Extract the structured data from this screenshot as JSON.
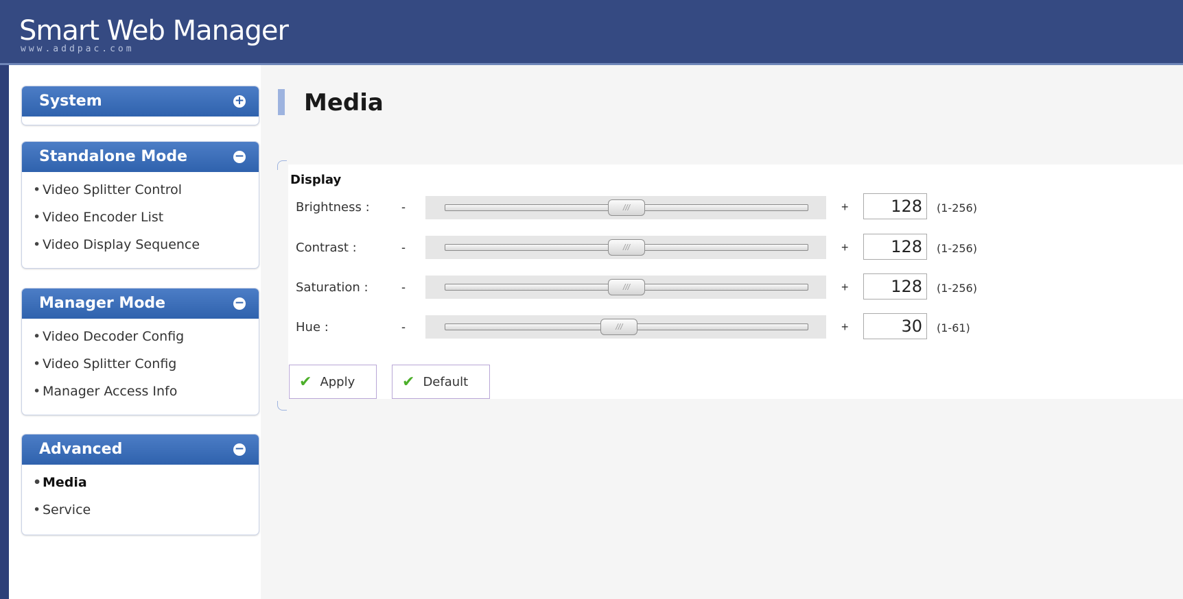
{
  "header": {
    "title": "Smart Web Manager",
    "subtitle": "www.addpac.com"
  },
  "sidebar": {
    "panels": [
      {
        "title": "System",
        "toggle": "+",
        "items": []
      },
      {
        "title": "Standalone Mode",
        "toggle": "−",
        "items": [
          "Video Splitter Control",
          "Video Encoder List",
          "Video Display Sequence"
        ]
      },
      {
        "title": "Manager Mode",
        "toggle": "−",
        "items": [
          "Video Decoder Config",
          "Video Splitter Config",
          "Manager Access Info"
        ]
      },
      {
        "title": "Advanced",
        "toggle": "−",
        "items": [
          "Media",
          "Service"
        ],
        "active_item": "Media"
      }
    ]
  },
  "main": {
    "page_title": "Media",
    "section_title": "Display",
    "minus_symbol": "-",
    "plus_symbol": "+",
    "slider_grip": "///",
    "rows": [
      {
        "label": "Brightness :",
        "value": "128",
        "range": "(1-256)",
        "level": 0.5
      },
      {
        "label": "Contrast :",
        "value": "128",
        "range": "(1-256)",
        "level": 0.5
      },
      {
        "label": "Saturation :",
        "value": "128",
        "range": "(1-256)",
        "level": 0.5
      },
      {
        "label": "Hue :",
        "value": "30",
        "range": "(1-61)",
        "level": 0.48
      }
    ],
    "buttons": {
      "apply": "Apply",
      "default": "Default",
      "check_icon": "✔"
    }
  },
  "colors": {
    "header_bg": "#354a82",
    "panel_head": "#2f62ad",
    "accent_bar": "#9db3df",
    "check": "#4caf2a"
  }
}
